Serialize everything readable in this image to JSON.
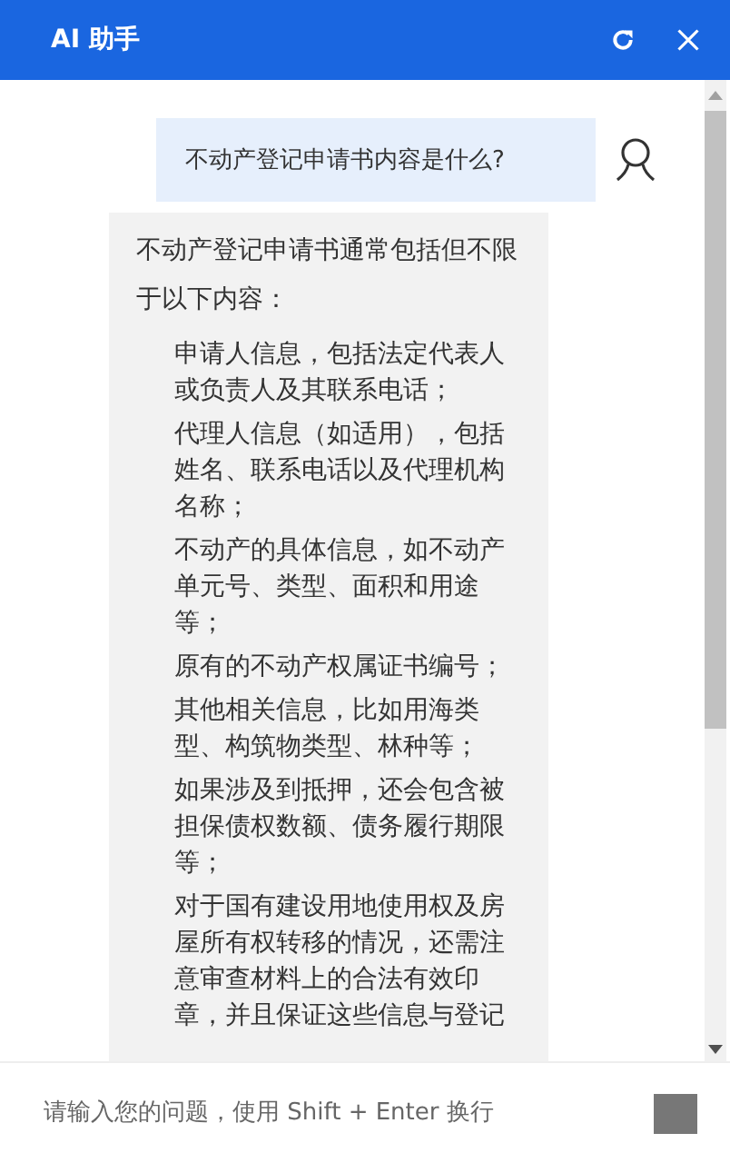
{
  "window": {
    "title": "AI 助手"
  },
  "messages": [
    {
      "kind": "user",
      "text": "不动产登记申请书内容是什么?"
    },
    {
      "kind": "assistant",
      "intro": "不动产登记申请书通常包括但不限于以下内容：",
      "items": [
        "申请人信息，包括法定代表人或负责人及其联系电话；",
        "代理人信息（如适用），包括姓名、联系电话以及代理机构名称；",
        "不动产的具体信息，如不动产单元号、类型、面积和用途等；",
        "原有的不动产权属证书编号；",
        "其他相关信息，比如用海类型、构筑物类型、林种等；",
        "如果涉及到抵押，还会包含被担保债权数额、债务履行期限等；",
        "对于国有建设用地使用权及房屋所有权转移的情况，还需注意审查材料上的合法有效印章，并且保证这些信息与登记"
      ]
    }
  ],
  "input": {
    "placeholder": "请输入您的问题，使用 Shift + Enter 换行"
  }
}
